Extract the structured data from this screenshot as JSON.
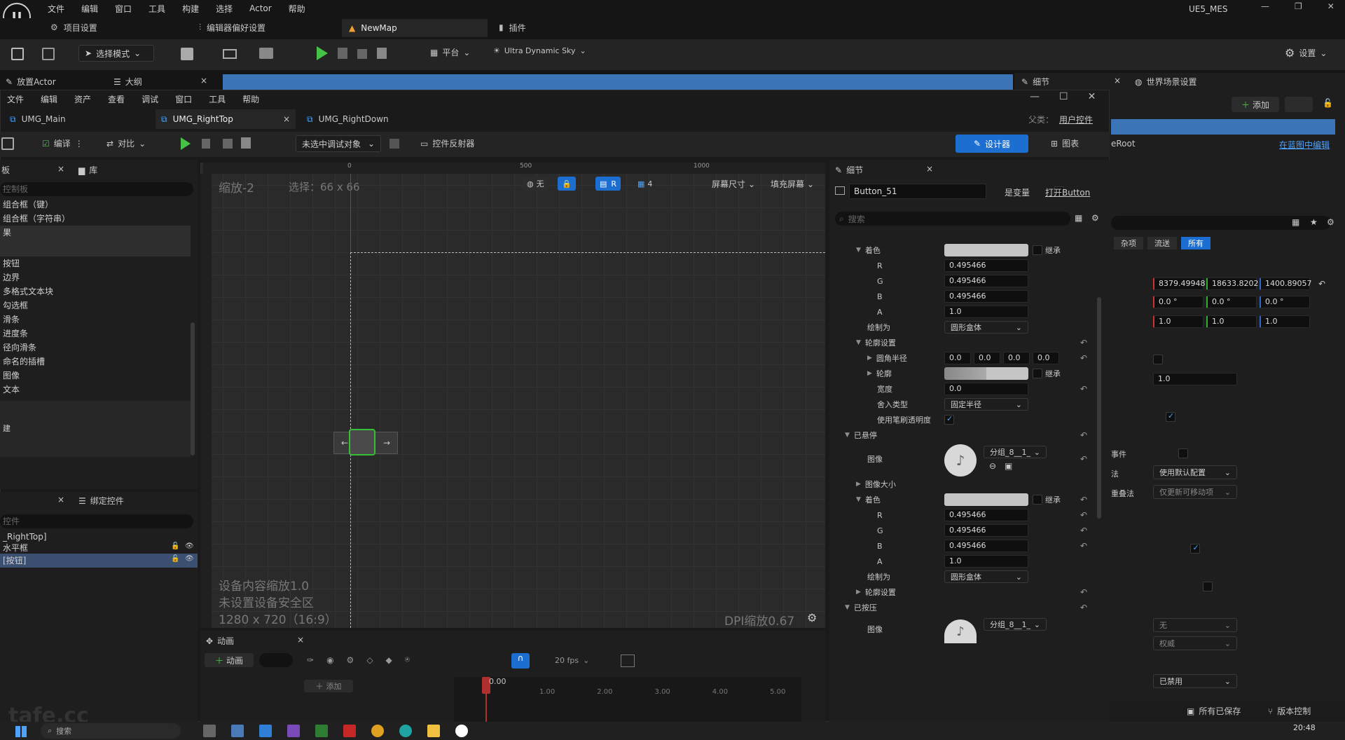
{
  "app": {
    "title": "UE5_MES",
    "window_controls": [
      "—",
      "❐",
      "✕"
    ]
  },
  "menu": [
    "文件",
    "编辑",
    "窗口",
    "工具",
    "构建",
    "选择",
    "Actor",
    "帮助"
  ],
  "top_tabs": [
    {
      "label": "项目设置"
    },
    {
      "label": "编辑器偏好设置"
    },
    {
      "label": "NewMap"
    },
    {
      "label": "插件"
    }
  ],
  "main_toolbar": {
    "mode": "选择模式",
    "platform": "平台",
    "sky": "Ultra Dynamic Sky",
    "settings": "设置"
  },
  "left_tabs": [
    "放置Actor",
    "大纲"
  ],
  "right_panel": {
    "tabs": [
      "细节",
      "世界场景设置"
    ],
    "add": "添加",
    "root": "eRoot",
    "edit_in_bp": "在蓝图中编辑",
    "filters": [
      "杂项",
      "流送",
      "所有"
    ],
    "location": [
      "8379.49948",
      "18633.8202",
      "1400.89057"
    ],
    "rotation": [
      "0.0 °",
      "0.0 °",
      "0.0 °"
    ],
    "scale": [
      "1.0",
      "1.0",
      "1.0"
    ],
    "value1": "1.0",
    "labels": [
      "事件",
      "法",
      "重叠法"
    ],
    "dd1": "使用默认配置",
    "dd2": "仅更新可移动项",
    "dd3": "无",
    "dd4": "权威",
    "dd5": "已禁用"
  },
  "umg": {
    "menu": [
      "文件",
      "编辑",
      "资产",
      "查看",
      "调试",
      "窗口",
      "工具",
      "帮助"
    ],
    "tabs": [
      "UMG_Main",
      "UMG_RightTop",
      "UMG_RightDown"
    ],
    "parent_label": "父类：",
    "parent_value": "用户控件",
    "toolbar": {
      "compile": "编译",
      "diff": "对比",
      "debug_target": "未选中调试对象",
      "reflector": "控件反射器",
      "designer": "设计器",
      "graph": "图表"
    },
    "palette": {
      "title": "板",
      "library": "库",
      "search": "控制板",
      "items": [
        "组合框（键）",
        "组合框（字符串）",
        "果",
        "按钮",
        "边界",
        "多格式文本块",
        "勾选框",
        "滑条",
        "进度条",
        "径向滑条",
        "命名的插槽",
        "图像",
        "文本",
        "建"
      ]
    },
    "hierarchy": {
      "title": "绑定控件",
      "search": "控件",
      "items": [
        "_RightTop]",
        "水平框",
        "[按钮]"
      ]
    },
    "canvas": {
      "zoom": "缩放-2",
      "selection": "选择：66 x 66",
      "ruler": [
        "0",
        "500",
        "1000"
      ],
      "toolbar": {
        "none": "无",
        "r": "R",
        "grid": "4",
        "screen_size": "屏幕尺寸",
        "fill": "填充屏幕"
      },
      "device_scale": "设备内容缩放1.0",
      "safe_zone": "未设置设备安全区",
      "resolution": "1280 x 720（16:9）",
      "dpi": "DPI缩放0.67"
    },
    "animation": {
      "tab": "动画",
      "add_anim": "动画",
      "add_track": "添加",
      "fps": "20 fps",
      "time": "0.00",
      "ticks": [
        "1.00",
        "2.00",
        "3.00",
        "4.00",
        "5.00"
      ]
    },
    "details": {
      "title": "细节",
      "name": "Button_51",
      "is_variable": "是变量",
      "open_button": "打开Button",
      "search": "搜索",
      "tint": "着色",
      "inherit": "继承",
      "r": "R",
      "g": "G",
      "b": "B",
      "a": "A",
      "rgb": "0.495466",
      "alpha": "1.0",
      "draw_as": "绘制为",
      "draw_as_value": "圆形盒体",
      "outline_settings": "轮廓设置",
      "corner_radius": "圆角半径",
      "corner_values": [
        "0.0",
        "0.0",
        "0.0",
        "0.0"
      ],
      "outline": "轮廓",
      "width": "宽度",
      "width_value": "0.0",
      "rounding_type": "舍入类型",
      "rounding_value": "固定半径",
      "use_brush_alpha": "使用笔刷透明度",
      "hovered": "已悬停",
      "image": "图像",
      "image_value": "分组_8__1_",
      "image_size": "图像大小",
      "pressed": "已按压"
    }
  },
  "status_bar": {
    "saved": "所有已保存",
    "vcs": "版本控制"
  },
  "taskbar": {
    "search": "搜索",
    "time": "20:48"
  },
  "watermark": "tafe.cc"
}
